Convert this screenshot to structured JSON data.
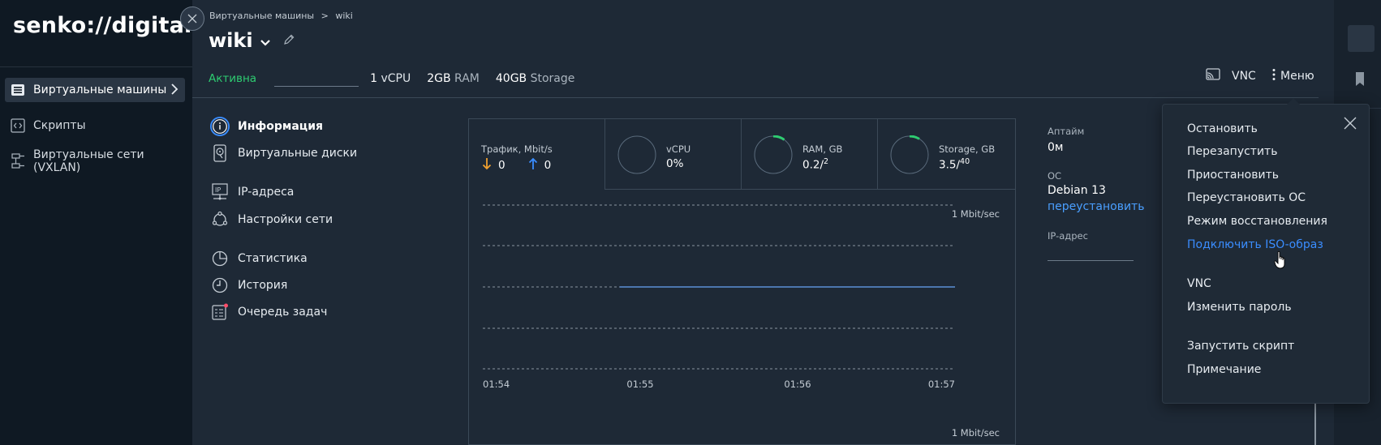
{
  "brand": {
    "logo": "senko://digital"
  },
  "sidebar": {
    "items": [
      {
        "label": "Виртуальные машины",
        "icon": "vm-list-icon",
        "active": true
      },
      {
        "label": "Скрипты",
        "icon": "script-icon",
        "active": false
      },
      {
        "label": "Виртуальные сети (VXLAN)",
        "icon": "network-icon",
        "active": false
      }
    ]
  },
  "header": {
    "breadcrumb": [
      "Виртуальные машины",
      ">",
      "wiki"
    ],
    "title": "wiki",
    "status": "Активна",
    "specs": [
      {
        "value": "1",
        "unit": "vCPU"
      },
      {
        "value": "2GB",
        "unit": "RAM"
      },
      {
        "value": "40GB",
        "unit": "Storage"
      }
    ],
    "vnc_label": "VNC",
    "menu_label": "Меню"
  },
  "sections": [
    {
      "label": "Информация",
      "icon": "info-icon",
      "active": true
    },
    {
      "label": "Виртуальные диски",
      "icon": "disk-icon",
      "active": false
    },
    {
      "label": "IP-адреса",
      "icon": "ip-icon",
      "active": false
    },
    {
      "label": "Настройки сети",
      "icon": "network-settings-icon",
      "active": false
    },
    {
      "label": "Статистика",
      "icon": "pie-chart-icon",
      "active": false
    },
    {
      "label": "История",
      "icon": "clock-icon",
      "active": false
    },
    {
      "label": "Очередь задач",
      "icon": "task-queue-icon",
      "active": false
    }
  ],
  "stats": {
    "traffic": {
      "label": "Трафик, Mbit/s",
      "down": "0",
      "up": "0"
    },
    "vcpu": {
      "label": "vCPU",
      "value": "0%",
      "fraction": 0
    },
    "ram": {
      "label": "RAM, GB",
      "used": "0.2",
      "total": "2",
      "fraction": 0.1
    },
    "storage": {
      "label": "Storage, GB",
      "used": "3.5",
      "total": "40",
      "fraction": 0.0875
    }
  },
  "chart_data": {
    "type": "line",
    "x": [
      "01:54",
      "01:55",
      "01:56",
      "01:57"
    ],
    "top_label": "1 Mbit/sec",
    "bottom_label": "1 Mbit/sec",
    "series": [
      {
        "values": [
          null,
          0,
          0,
          0
        ]
      }
    ]
  },
  "info": {
    "uptime_label": "Аптайм",
    "uptime_value": "0м",
    "os_label": "ОС",
    "os_value": "Debian 13",
    "reinstall_link": "переустановить",
    "ip_label": "IP-адрес"
  },
  "menu": {
    "items": [
      "Остановить",
      "Перезапустить",
      "Приостановить",
      "Переустановить ОС",
      "Режим восстановления",
      "Подключить ISO-образ",
      "VNC",
      "Изменить пароль",
      "Запустить скрипт",
      "Примечание"
    ],
    "hovered": "Подключить ISO-образ"
  },
  "colors": {
    "active_status": "#2ecc71",
    "link": "#4a9fff",
    "accent_blue": "#3a8dff",
    "down_arrow": "#f0a030"
  }
}
